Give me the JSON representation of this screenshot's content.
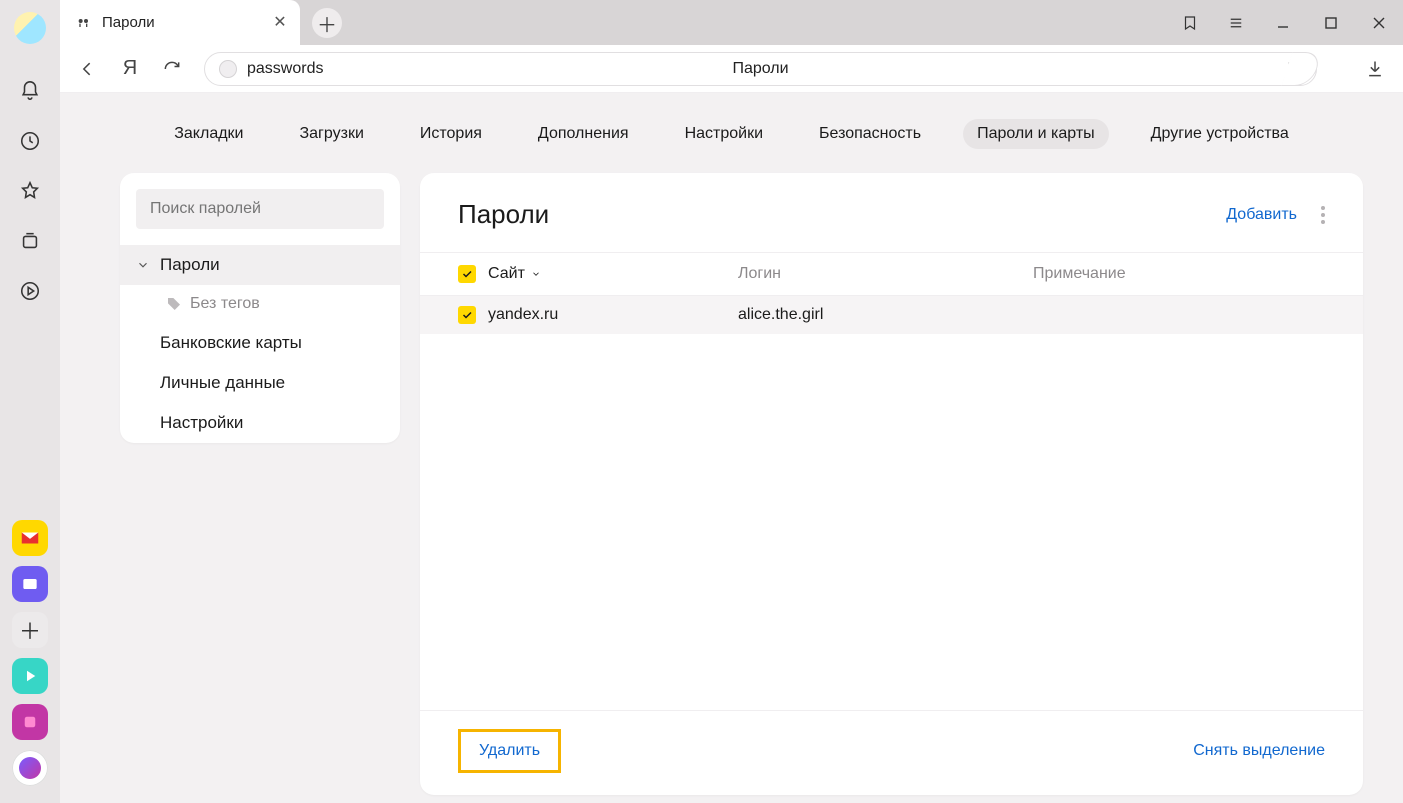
{
  "tab": {
    "title": "Пароли"
  },
  "address": {
    "value": "passwords",
    "center_label": "Пароли"
  },
  "topnav": {
    "items": [
      "Закладки",
      "Загрузки",
      "История",
      "Дополнения",
      "Настройки",
      "Безопасность",
      "Пароли и карты",
      "Другие устройства"
    ],
    "active_index": 6
  },
  "leftpanel": {
    "search_placeholder": "Поиск паролей",
    "cat_passwords": "Пароли",
    "sub_no_tags": "Без тегов",
    "cat_cards": "Банковские карты",
    "cat_personal": "Личные данные",
    "cat_settings": "Настройки"
  },
  "rightpanel": {
    "title": "Пароли",
    "add": "Добавить",
    "columns": {
      "site": "Сайт",
      "login": "Логин",
      "note": "Примечание"
    },
    "rows": [
      {
        "site": "yandex.ru",
        "login": "alice.the.girl",
        "note": ""
      }
    ],
    "delete": "Удалить",
    "clear_selection": "Снять выделение"
  }
}
